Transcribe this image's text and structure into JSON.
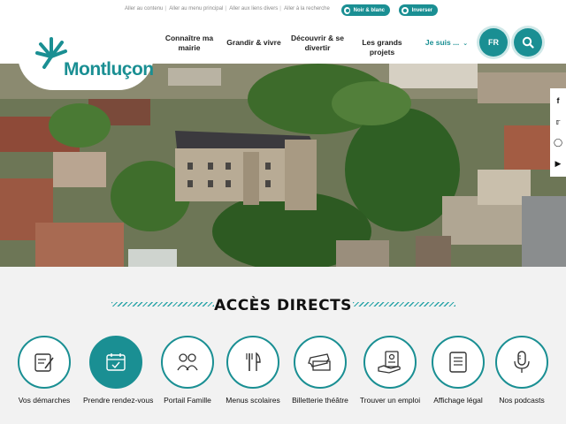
{
  "skip_links": [
    "Aller au contenu",
    "Aller au menu principal",
    "Aller aux liens divers",
    "Aller à la recherche"
  ],
  "contrast": {
    "black_white": "Noir & blanc",
    "invert": "Inverser"
  },
  "logo": {
    "text": "Montluçon",
    "icon": "sun-star-logo-icon"
  },
  "nav": {
    "item1": "Connaître ma mairie",
    "item2": "Grandir & vivre",
    "item3": "Découvrir & se divertir",
    "item4": "Les grands projets",
    "item5": "Je suis ...",
    "item5_icon": "chevron-down-icon"
  },
  "language": "FR",
  "search_icon": "search-icon",
  "social": [
    "facebook-icon",
    "twitter-icon",
    "instagram-icon",
    "youtube-icon"
  ],
  "hero_alt": "Vue aérienne du château de Montluçon",
  "acces": {
    "title": "ACCÈS DIRECTS",
    "items": [
      {
        "label": "Vos démarches",
        "icon": "form-pencil-icon"
      },
      {
        "label": "Prendre rendez-vous",
        "icon": "calendar-check-icon"
      },
      {
        "label": "Portail Famille",
        "icon": "family-icon"
      },
      {
        "label": "Menus scolaires",
        "icon": "fork-knife-icon"
      },
      {
        "label": "Billetterie théâtre",
        "icon": "ticket-icon"
      },
      {
        "label": "Trouver un emploi",
        "icon": "job-offer-icon"
      },
      {
        "label": "Affichage légal",
        "icon": "document-icon"
      },
      {
        "label": "Nos podcasts",
        "icon": "microphone-icon"
      }
    ]
  },
  "colors": {
    "accent": "#1a8f93",
    "accent_light": "#2aa4a8"
  }
}
